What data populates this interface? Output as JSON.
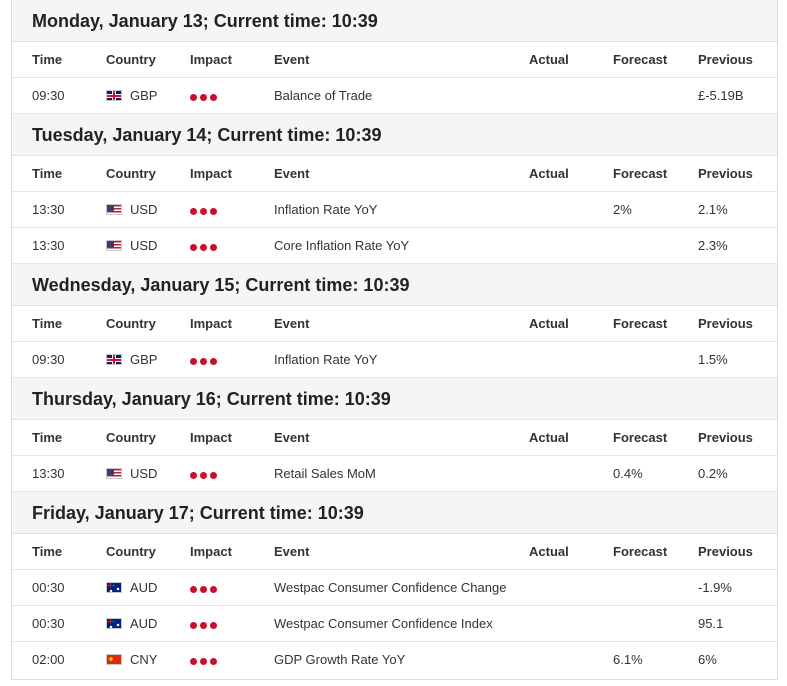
{
  "columns": {
    "time": "Time",
    "country": "Country",
    "impact": "Impact",
    "event": "Event",
    "actual": "Actual",
    "forecast": "Forecast",
    "previous": "Previous"
  },
  "days": [
    {
      "title": "Monday, January 13; Current time: 10:39",
      "events": [
        {
          "time": "09:30",
          "country": "GBP",
          "flag": "gbp-flag-icon",
          "impact": 3,
          "event": "Balance of Trade",
          "actual": "",
          "forecast": "",
          "previous": "£-5.19B"
        }
      ]
    },
    {
      "title": "Tuesday, January 14; Current time: 10:39",
      "events": [
        {
          "time": "13:30",
          "country": "USD",
          "flag": "usd-flag-icon",
          "impact": 3,
          "event": "Inflation Rate YoY",
          "actual": "",
          "forecast": "2%",
          "previous": "2.1%"
        },
        {
          "time": "13:30",
          "country": "USD",
          "flag": "usd-flag-icon",
          "impact": 3,
          "event": "Core Inflation Rate YoY",
          "actual": "",
          "forecast": "",
          "previous": "2.3%"
        }
      ]
    },
    {
      "title": "Wednesday, January 15; Current time: 10:39",
      "events": [
        {
          "time": "09:30",
          "country": "GBP",
          "flag": "gbp-flag-icon",
          "impact": 3,
          "event": "Inflation Rate YoY",
          "actual": "",
          "forecast": "",
          "previous": "1.5%"
        }
      ]
    },
    {
      "title": "Thursday, January 16; Current time: 10:39",
      "events": [
        {
          "time": "13:30",
          "country": "USD",
          "flag": "usd-flag-icon",
          "impact": 3,
          "event": "Retail Sales MoM",
          "actual": "",
          "forecast": "0.4%",
          "previous": "0.2%"
        }
      ]
    },
    {
      "title": "Friday, January 17; Current time: 10:39",
      "events": [
        {
          "time": "00:30",
          "country": "AUD",
          "flag": "aud-flag-icon",
          "impact": 3,
          "event": "Westpac Consumer Confidence Change",
          "actual": "",
          "forecast": "",
          "previous": "-1.9%"
        },
        {
          "time": "00:30",
          "country": "AUD",
          "flag": "aud-flag-icon",
          "impact": 3,
          "event": "Westpac Consumer Confidence Index",
          "actual": "",
          "forecast": "",
          "previous": "95.1"
        },
        {
          "time": "02:00",
          "country": "CNY",
          "flag": "cny-flag-icon",
          "impact": 3,
          "event": "GDP Growth Rate YoY",
          "actual": "",
          "forecast": "6.1%",
          "previous": "6%"
        }
      ]
    }
  ],
  "colors": {
    "impact_high": "#c8102e",
    "day_header_bg": "#f5f5f5",
    "border": "#e6e6e6"
  }
}
